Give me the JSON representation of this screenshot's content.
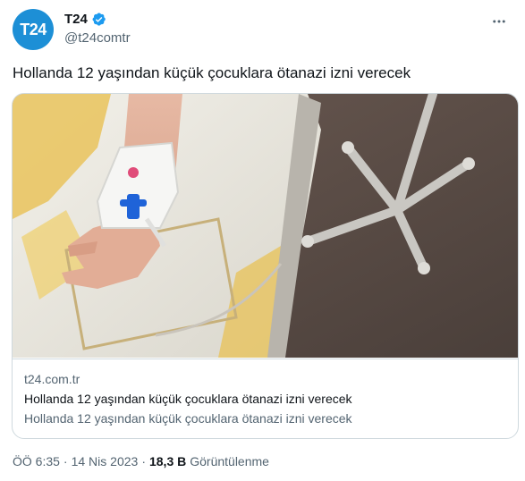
{
  "author": {
    "avatar_text": "T24",
    "display_name": "T24",
    "handle": "@t24comtr",
    "brand_color": "#1d8fd6",
    "verified_color": "#1d9bf0"
  },
  "tweet": {
    "text": "Hollanda 12 yaşından küçük çocuklara ötanazi izni verecek"
  },
  "card": {
    "domain": "t24.com.tr",
    "title": "Hollanda 12 yaşından küçük çocuklara ötanazi izni verecek",
    "description": "Hollanda 12 yaşından küçük çocuklara ötanazi izni verecek"
  },
  "footer": {
    "time": "ÖÖ 6:35",
    "separator1": "·",
    "date": "14 Nis 2023",
    "separator2": "·",
    "views_count": "18,3 B",
    "views_label": "Görüntülenme"
  },
  "icons": {
    "verified": "verified-badge-icon",
    "more": "more-options-icon"
  }
}
